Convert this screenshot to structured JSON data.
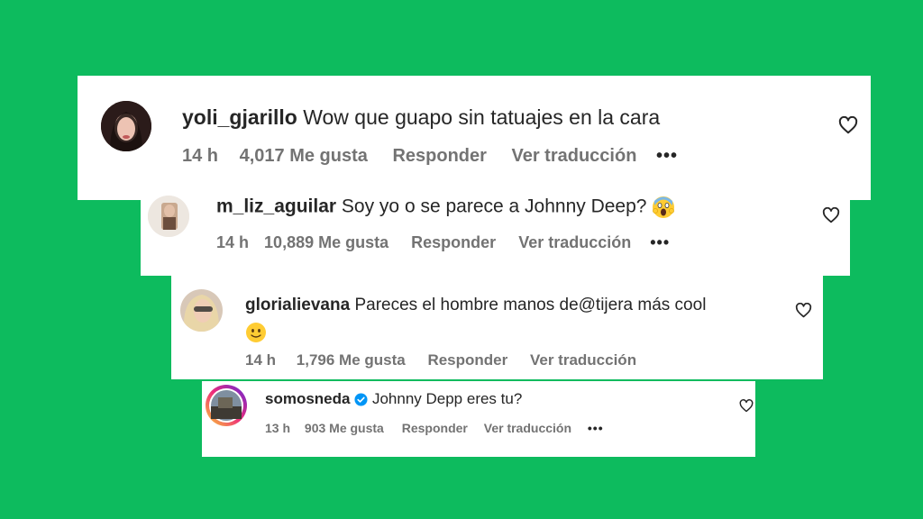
{
  "comments": [
    {
      "username": "yoli_gjarillo",
      "text": "Wow que guapo sin tatuajes en la cara",
      "time": "14 h",
      "likes": "4,017 Me gusta",
      "reply": "Responder",
      "translate": "Ver traducción",
      "more": "•••"
    },
    {
      "username": "m_liz_aguilar",
      "text": "Soy yo o se parece a Johnny Deep?",
      "emoji": "face-screaming-in-fear",
      "time": "14 h",
      "likes": "10,889 Me gusta",
      "reply": "Responder",
      "translate": "Ver traducción",
      "more": "•••"
    },
    {
      "username": "glorialievana",
      "text": "Pareces el hombre manos de@tijera más cool",
      "emoji": "slightly-smiling-face",
      "time": "14 h",
      "likes": "1,796 Me gusta",
      "reply": "Responder",
      "translate": "Ver traducción"
    },
    {
      "username": "somosneda",
      "verified": true,
      "text": "Johnny Depp eres tu?",
      "time": "13 h",
      "likes": "903 Me gusta",
      "reply": "Responder",
      "translate": "Ver traducción",
      "more": "•••"
    }
  ],
  "colors": {
    "background": "#0dbb5e",
    "card": "#ffffff",
    "text": "#262626",
    "meta": "#737373",
    "verified": "#0095f6"
  }
}
